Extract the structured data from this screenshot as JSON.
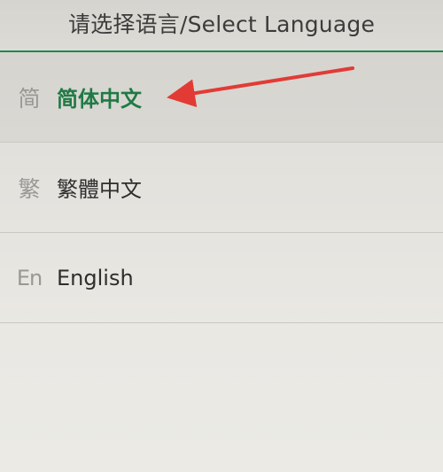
{
  "header": {
    "title": "请选择语言/Select Language"
  },
  "languages": [
    {
      "icon": "简",
      "label": "简体中文",
      "selected": true
    },
    {
      "icon": "繁",
      "label": "繁體中文",
      "selected": false
    },
    {
      "icon": "En",
      "label": "English",
      "selected": false
    }
  ],
  "colors": {
    "accent": "#1f8a4c",
    "selected_text": "#1f7a45",
    "annotation_arrow": "#e23b36"
  },
  "icons": {
    "annotation": "red-arrow-icon"
  }
}
